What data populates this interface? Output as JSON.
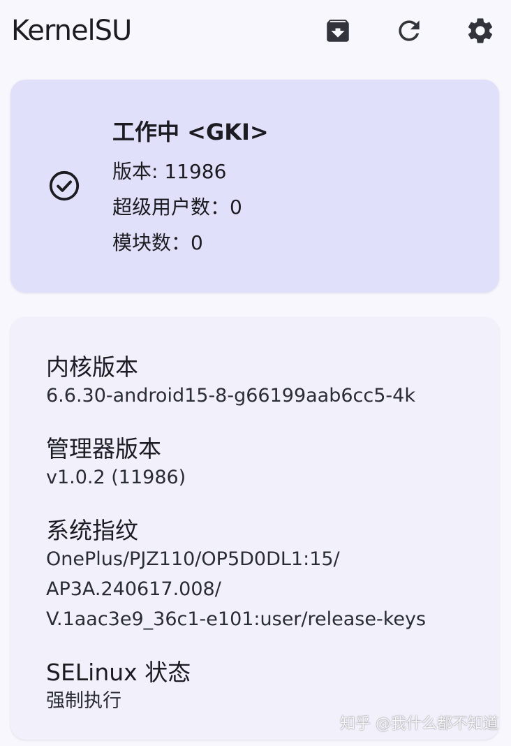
{
  "app_bar": {
    "title": "KernelSU",
    "actions": [
      {
        "icon": "archive-download-icon"
      },
      {
        "icon": "refresh-icon"
      },
      {
        "icon": "settings-gear-icon"
      }
    ]
  },
  "status_card": {
    "icon": "check-circle-icon",
    "title": "工作中 <GKI>",
    "version": "版本: 11986",
    "superusers": "超级用户数：0",
    "modules": "模块数：0",
    "background_color": "#e1e0fa"
  },
  "info_card": {
    "kernel_label": "内核版本",
    "kernel_value": "6.6.30-android15-8-g66199aab6cc5-4k",
    "manager_label": "管理器版本",
    "manager_value": "v1.0.2 (11986)",
    "fingerprint_label": "系统指纹",
    "fingerprint_lines": [
      "OnePlus/PJZ110/OP5D0DL1:15/",
      "AP3A.240617.008/",
      "V.1aac3e9_36c1-e101:user/release-keys"
    ],
    "selinux_label": "SELinux 状态",
    "selinux_value": "强制执行"
  },
  "watermark": "知乎 @我什么都不知道",
  "colors": {
    "background": "#f7f7fd",
    "info_card_background": "#f1f0fb",
    "text": "#1b1b21",
    "icon": "#33333b"
  }
}
